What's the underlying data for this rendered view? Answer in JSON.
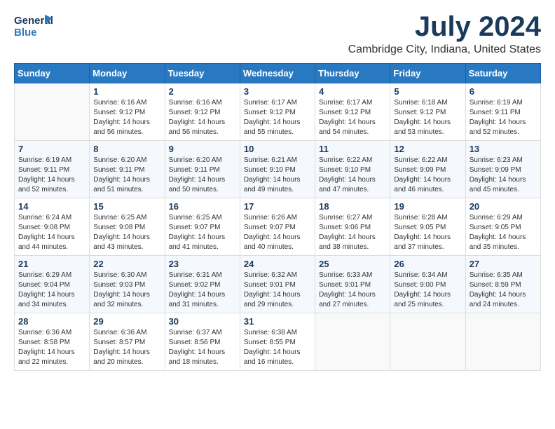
{
  "header": {
    "logo_line1": "General",
    "logo_line2": "Blue",
    "title": "July 2024",
    "subtitle": "Cambridge City, Indiana, United States"
  },
  "days_of_week": [
    "Sunday",
    "Monday",
    "Tuesday",
    "Wednesday",
    "Thursday",
    "Friday",
    "Saturday"
  ],
  "weeks": [
    [
      {
        "day": "",
        "info": ""
      },
      {
        "day": "1",
        "info": "Sunrise: 6:16 AM\nSunset: 9:12 PM\nDaylight: 14 hours\nand 56 minutes."
      },
      {
        "day": "2",
        "info": "Sunrise: 6:16 AM\nSunset: 9:12 PM\nDaylight: 14 hours\nand 56 minutes."
      },
      {
        "day": "3",
        "info": "Sunrise: 6:17 AM\nSunset: 9:12 PM\nDaylight: 14 hours\nand 55 minutes."
      },
      {
        "day": "4",
        "info": "Sunrise: 6:17 AM\nSunset: 9:12 PM\nDaylight: 14 hours\nand 54 minutes."
      },
      {
        "day": "5",
        "info": "Sunrise: 6:18 AM\nSunset: 9:12 PM\nDaylight: 14 hours\nand 53 minutes."
      },
      {
        "day": "6",
        "info": "Sunrise: 6:19 AM\nSunset: 9:11 PM\nDaylight: 14 hours\nand 52 minutes."
      }
    ],
    [
      {
        "day": "7",
        "info": "Sunrise: 6:19 AM\nSunset: 9:11 PM\nDaylight: 14 hours\nand 52 minutes."
      },
      {
        "day": "8",
        "info": "Sunrise: 6:20 AM\nSunset: 9:11 PM\nDaylight: 14 hours\nand 51 minutes."
      },
      {
        "day": "9",
        "info": "Sunrise: 6:20 AM\nSunset: 9:11 PM\nDaylight: 14 hours\nand 50 minutes."
      },
      {
        "day": "10",
        "info": "Sunrise: 6:21 AM\nSunset: 9:10 PM\nDaylight: 14 hours\nand 49 minutes."
      },
      {
        "day": "11",
        "info": "Sunrise: 6:22 AM\nSunset: 9:10 PM\nDaylight: 14 hours\nand 47 minutes."
      },
      {
        "day": "12",
        "info": "Sunrise: 6:22 AM\nSunset: 9:09 PM\nDaylight: 14 hours\nand 46 minutes."
      },
      {
        "day": "13",
        "info": "Sunrise: 6:23 AM\nSunset: 9:09 PM\nDaylight: 14 hours\nand 45 minutes."
      }
    ],
    [
      {
        "day": "14",
        "info": "Sunrise: 6:24 AM\nSunset: 9:08 PM\nDaylight: 14 hours\nand 44 minutes."
      },
      {
        "day": "15",
        "info": "Sunrise: 6:25 AM\nSunset: 9:08 PM\nDaylight: 14 hours\nand 43 minutes."
      },
      {
        "day": "16",
        "info": "Sunrise: 6:25 AM\nSunset: 9:07 PM\nDaylight: 14 hours\nand 41 minutes."
      },
      {
        "day": "17",
        "info": "Sunrise: 6:26 AM\nSunset: 9:07 PM\nDaylight: 14 hours\nand 40 minutes."
      },
      {
        "day": "18",
        "info": "Sunrise: 6:27 AM\nSunset: 9:06 PM\nDaylight: 14 hours\nand 38 minutes."
      },
      {
        "day": "19",
        "info": "Sunrise: 6:28 AM\nSunset: 9:05 PM\nDaylight: 14 hours\nand 37 minutes."
      },
      {
        "day": "20",
        "info": "Sunrise: 6:29 AM\nSunset: 9:05 PM\nDaylight: 14 hours\nand 35 minutes."
      }
    ],
    [
      {
        "day": "21",
        "info": "Sunrise: 6:29 AM\nSunset: 9:04 PM\nDaylight: 14 hours\nand 34 minutes."
      },
      {
        "day": "22",
        "info": "Sunrise: 6:30 AM\nSunset: 9:03 PM\nDaylight: 14 hours\nand 32 minutes."
      },
      {
        "day": "23",
        "info": "Sunrise: 6:31 AM\nSunset: 9:02 PM\nDaylight: 14 hours\nand 31 minutes."
      },
      {
        "day": "24",
        "info": "Sunrise: 6:32 AM\nSunset: 9:01 PM\nDaylight: 14 hours\nand 29 minutes."
      },
      {
        "day": "25",
        "info": "Sunrise: 6:33 AM\nSunset: 9:01 PM\nDaylight: 14 hours\nand 27 minutes."
      },
      {
        "day": "26",
        "info": "Sunrise: 6:34 AM\nSunset: 9:00 PM\nDaylight: 14 hours\nand 25 minutes."
      },
      {
        "day": "27",
        "info": "Sunrise: 6:35 AM\nSunset: 8:59 PM\nDaylight: 14 hours\nand 24 minutes."
      }
    ],
    [
      {
        "day": "28",
        "info": "Sunrise: 6:36 AM\nSunset: 8:58 PM\nDaylight: 14 hours\nand 22 minutes."
      },
      {
        "day": "29",
        "info": "Sunrise: 6:36 AM\nSunset: 8:57 PM\nDaylight: 14 hours\nand 20 minutes."
      },
      {
        "day": "30",
        "info": "Sunrise: 6:37 AM\nSunset: 8:56 PM\nDaylight: 14 hours\nand 18 minutes."
      },
      {
        "day": "31",
        "info": "Sunrise: 6:38 AM\nSunset: 8:55 PM\nDaylight: 14 hours\nand 16 minutes."
      },
      {
        "day": "",
        "info": ""
      },
      {
        "day": "",
        "info": ""
      },
      {
        "day": "",
        "info": ""
      }
    ]
  ]
}
